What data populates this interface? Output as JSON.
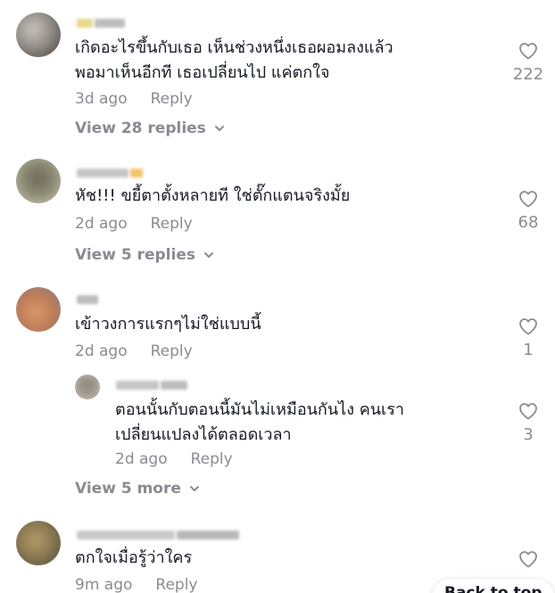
{
  "comments": [
    {
      "text": "เกิดอะไรขึ้นกับเธอ เห็นช่วงหนึ่งเธอผอมลงแล้ว\nพอมาเห็นอีกที เธอเปลี่ยนไป แค่ตกใจ",
      "time": "3d ago",
      "reply_label": "Reply",
      "likes": "222",
      "view_replies": "View 28 replies"
    },
    {
      "text": "หัช!!! ขยี้ตาตั้งหลายที ใช่ตั๊กแตนจริงมั้ย",
      "time": "2d ago",
      "reply_label": "Reply",
      "likes": "68",
      "view_replies": "View 5 replies"
    },
    {
      "text": "เข้าวงการแรกๆไม่ใช่แบบนี้",
      "time": "2d ago",
      "reply_label": "Reply",
      "likes": "1"
    },
    {
      "text": "ตกใจเมื่อรู้ว่าใคร",
      "time": "9m ago",
      "reply_label": "Reply"
    }
  ],
  "reply": {
    "text": "ตอนนั้นกับตอนนี้มันไม่เหมือนกันไง คนเรา\nเปลี่ยนแปลงได้ตลอดเวลา",
    "time": "2d ago",
    "reply_label": "Reply",
    "likes": "3"
  },
  "view_more": "View 5 more",
  "back_to_top": "Back to top",
  "colors": {
    "text_primary": "#161823",
    "text_secondary": "#8a8b91"
  },
  "icons": {
    "like": "heart-outline-icon",
    "expand": "chevron-down-icon"
  }
}
